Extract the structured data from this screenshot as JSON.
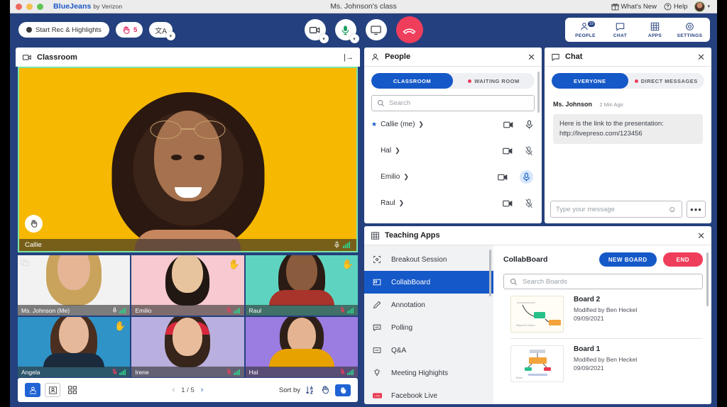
{
  "titlebar": {
    "brand": "BlueJeans",
    "brand_suffix": "by Verizon",
    "window_title": "Ms. Johnson's class",
    "whats_new": "What's New",
    "help": "Help",
    "gift_icon": "gift-icon",
    "help_icon": "question-circle-icon",
    "avatar_icon": "user-avatar",
    "caret_icon": "chevron-down-icon"
  },
  "toolbar": {
    "record_label": "Start Rec & Highlights",
    "raise_hand_count": "5",
    "raise_hand_icon": "raised-hand-icon",
    "language_label": "文A",
    "camera_icon": "camera-icon",
    "mic_icon": "microphone-icon",
    "share_screen_icon": "monitor-icon",
    "end_call_icon": "phone-hangup-icon",
    "nav": [
      {
        "label": "PEOPLE",
        "icon": "people-icon",
        "badge": "19"
      },
      {
        "label": "CHAT",
        "icon": "chat-bubble-icon",
        "badge": ""
      },
      {
        "label": "APPS",
        "icon": "grid-apps-icon",
        "badge": ""
      },
      {
        "label": "SETTINGS",
        "icon": "gear-icon",
        "badge": ""
      }
    ]
  },
  "classroom": {
    "title": "Classroom",
    "title_icon": "video-camera-icon",
    "expand_icon": "expand-right-icon",
    "main_speaker": {
      "name": "Callie",
      "mic_icon": "microphone-icon",
      "signal_icon": "signal-bars-icon",
      "badge_icon": "raised-hand-icon",
      "bg_color": "#f6b800"
    },
    "thumbnails": [
      {
        "name": "Ms. Johnson (Me)",
        "bg_color": "#f2f2f2",
        "mic_icon": "microphone-icon",
        "mic_muted": false,
        "signal_icon": "signal-bars-icon",
        "hand_raised": false,
        "pinned": true
      },
      {
        "name": "Emilio",
        "bg_color": "#f7c9d0",
        "mic_icon": "microphone-muted-icon",
        "mic_muted": true,
        "signal_icon": "signal-bars-icon",
        "hand_raised": true,
        "pinned": false
      },
      {
        "name": "Raul",
        "bg_color": "#5ed4c0",
        "mic_icon": "microphone-muted-icon",
        "mic_muted": true,
        "signal_icon": "signal-bars-icon",
        "hand_raised": true,
        "pinned": false
      },
      {
        "name": "Angela",
        "bg_color": "#2f93c7",
        "mic_icon": "microphone-muted-icon",
        "mic_muted": true,
        "signal_icon": "signal-bars-icon",
        "hand_raised": true,
        "pinned": false
      },
      {
        "name": "Irene",
        "bg_color": "#b9b0df",
        "mic_icon": "microphone-muted-icon",
        "mic_muted": true,
        "signal_icon": "signal-bars-icon",
        "hand_raised": false,
        "pinned": false
      },
      {
        "name": "Hal",
        "bg_color": "#9b7ce0",
        "mic_icon": "microphone-muted-icon",
        "mic_muted": true,
        "signal_icon": "signal-bars-icon",
        "hand_raised": false,
        "pinned": false
      }
    ],
    "bottom_bar": {
      "layout_speaker_icon": "speaker-layout-icon",
      "layout_single_icon": "single-layout-icon",
      "layout_grid_icon": "grid-layout-icon",
      "page_prev_icon": "chevron-left-icon",
      "page_next_icon": "chevron-right-icon",
      "page_indicator": "1 / 5",
      "sort_label": "Sort by",
      "sort_alpha_icon": "sort-alphabetical-icon",
      "sort_hand_icon": "raised-hand-icon",
      "sort_hand_selected_icon": "raised-hand-filled-icon"
    }
  },
  "people": {
    "title": "People",
    "title_icon": "person-icon",
    "close_icon": "close-icon",
    "tabs": [
      {
        "label": "CLASSROOM",
        "active": true,
        "dot": false
      },
      {
        "label": "WAITING ROOM",
        "active": false,
        "dot": true
      }
    ],
    "search_placeholder": "Search",
    "search_icon": "search-icon",
    "rows": [
      {
        "name": "Callie (me)",
        "starred": true,
        "camera_icon": "video-camera-icon",
        "mic_icon": "microphone-icon",
        "mic_muted": false,
        "mic_highlighted": false
      },
      {
        "name": "Hal",
        "starred": false,
        "camera_icon": "video-camera-icon",
        "mic_icon": "microphone-muted-icon",
        "mic_muted": true,
        "mic_highlighted": false
      },
      {
        "name": "Emilio",
        "starred": false,
        "camera_icon": "video-camera-icon",
        "mic_icon": "microphone-icon",
        "mic_muted": false,
        "mic_highlighted": true
      },
      {
        "name": "Raul",
        "starred": false,
        "camera_icon": "video-camera-icon",
        "mic_icon": "microphone-muted-icon",
        "mic_muted": true,
        "mic_highlighted": false
      }
    ]
  },
  "chat": {
    "title": "Chat",
    "title_icon": "chat-bubble-icon",
    "close_icon": "close-icon",
    "tabs": [
      {
        "label": "EVERYONE",
        "active": true,
        "dot": false
      },
      {
        "label": "DIRECT MESSAGES",
        "active": false,
        "dot": true
      }
    ],
    "messages": [
      {
        "author": "Ms. Johnson",
        "time": "2 Min Ago",
        "line1": "Here is the link to the presentation:",
        "line2": "http://livepreso.com/123456"
      }
    ],
    "input_placeholder": "Type your message",
    "emoji_icon": "smiley-icon",
    "more_icon": "ellipsis-icon"
  },
  "teaching_apps": {
    "title": "Teaching Apps",
    "title_icon": "grid-apps-icon",
    "close_icon": "close-icon",
    "nav_items": [
      {
        "label": "Breakout Session",
        "icon": "breakout-session-icon",
        "active": false
      },
      {
        "label": "CollabBoard",
        "icon": "collabboard-icon",
        "active": true
      },
      {
        "label": "Annotation",
        "icon": "pen-annotation-icon",
        "active": false
      },
      {
        "label": "Polling",
        "icon": "polling-icon",
        "active": false
      },
      {
        "label": "Q&A",
        "icon": "qa-icon",
        "active": false
      },
      {
        "label": "Meeting Highights",
        "icon": "lightbulb-icon",
        "active": false
      },
      {
        "label": "Facebook Live",
        "icon": "facebook-live-icon",
        "active": false
      }
    ],
    "detail": {
      "title": "CollabBoard",
      "new_board_label": "NEW BOARD",
      "end_label": "END",
      "search_placeholder": "Search Boards",
      "search_icon": "search-icon",
      "boards": [
        {
          "name": "Board 2",
          "modified_by": "Modified by Ben Heckel",
          "date": "09/09/2021",
          "thumb": "flowchart-thumb"
        },
        {
          "name": "Board 1",
          "modified_by": "Modified by Ben Heckel",
          "date": "09/09/2021",
          "thumb": "diagram-thumb"
        }
      ]
    }
  },
  "colors": {
    "brand_blue": "#24407e",
    "accent_blue": "#1558c8",
    "accent_pink": "#ef3e5c",
    "stage_border_green": "#7de3a8"
  }
}
